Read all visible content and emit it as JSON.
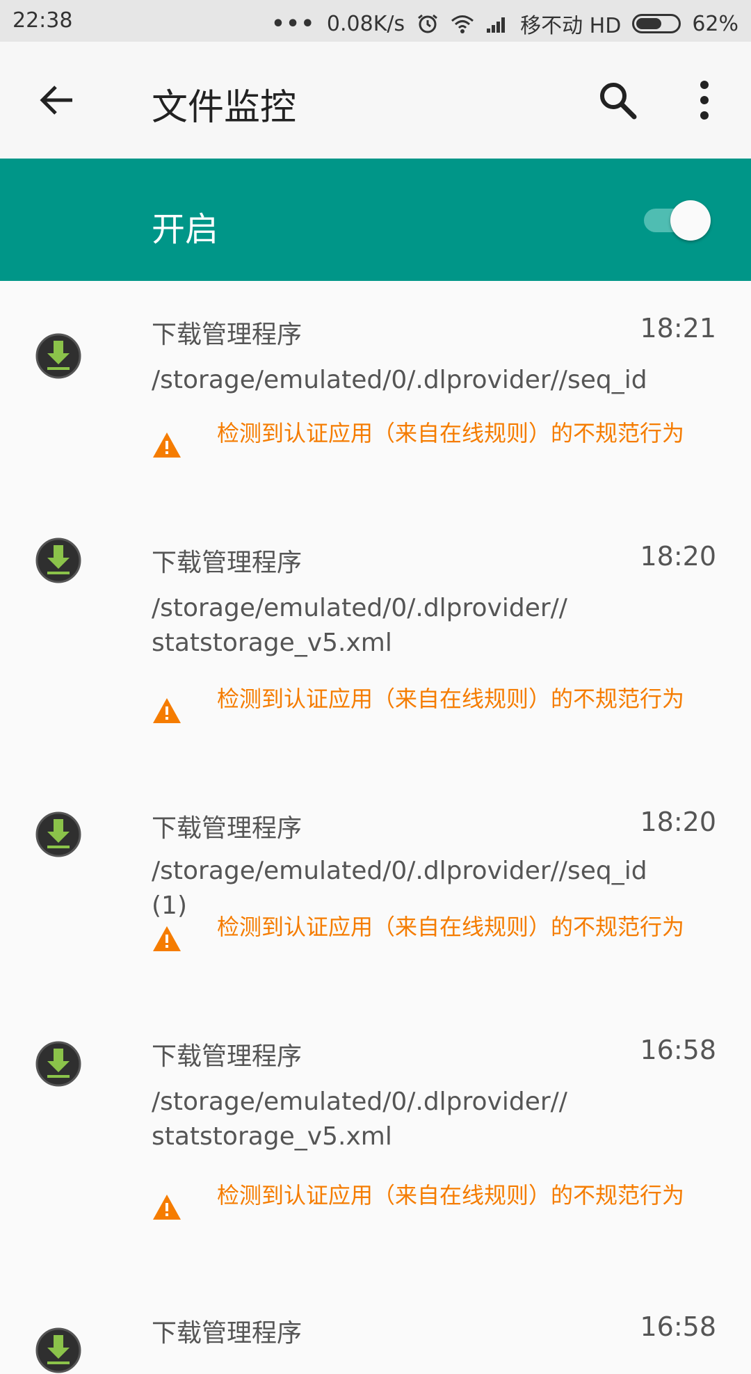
{
  "status_bar": {
    "time": "22:38",
    "dots": "•••",
    "net_speed": "0.08K/s",
    "carrier": "移不动 HD",
    "battery_percent": "62%",
    "battery_level": 0.62
  },
  "toolbar": {
    "title": "文件监控"
  },
  "switch": {
    "label": "开启",
    "on": true
  },
  "colors": {
    "accent": "#009688",
    "warning": "#f57c00"
  },
  "items": [
    {
      "app": "下载管理程序",
      "time": "18:21",
      "path": "/storage/emulated/0/.dlprovider//seq_id",
      "warning": "检测到认证应用（来自在线规则）的不规范行为"
    },
    {
      "app": "下载管理程序",
      "time": "18:20",
      "path": "/storage/emulated/0/.dlprovider//statstorage_v5.xml",
      "warning": "检测到认证应用（来自在线规则）的不规范行为"
    },
    {
      "app": "下载管理程序",
      "time": "18:20",
      "path": "/storage/emulated/0/.dlprovider//seq_id (1)",
      "warning": "检测到认证应用（来自在线规则）的不规范行为"
    },
    {
      "app": "下载管理程序",
      "time": "16:58",
      "path": "/storage/emulated/0/.dlprovider//statstorage_v5.xml",
      "warning": "检测到认证应用（来自在线规则）的不规范行为"
    },
    {
      "app": "下载管理程序",
      "time": "16:58"
    }
  ]
}
